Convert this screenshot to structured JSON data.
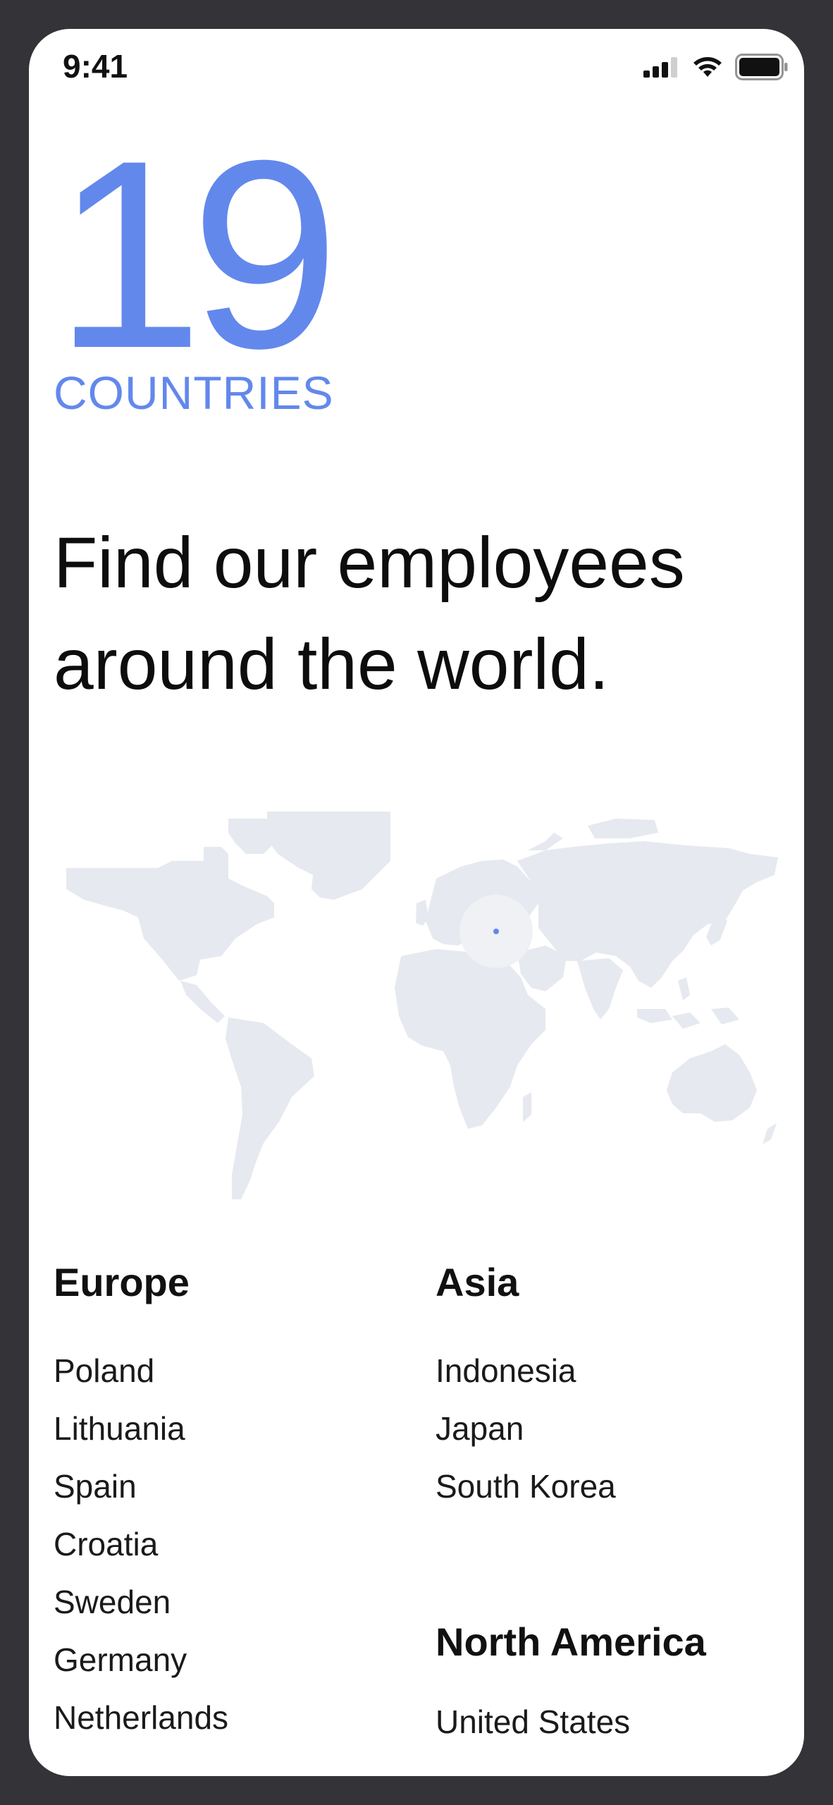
{
  "status_bar": {
    "time": "9:41",
    "icons": [
      "cellular-signal-icon",
      "wifi-icon",
      "battery-icon"
    ]
  },
  "hero": {
    "count": "19",
    "unit": "COUNTRIES",
    "headline_line1": "Find our employees",
    "headline_line2": "around the world."
  },
  "map": {
    "land_color": "#e6e9ef",
    "highlight_color": "#6388ec"
  },
  "regions": {
    "europe": {
      "title": "Europe",
      "countries": [
        "Poland",
        "Lithuania",
        "Spain",
        "Croatia",
        "Sweden",
        "Germany",
        "Netherlands"
      ]
    },
    "asia": {
      "title": "Asia",
      "countries": [
        "Indonesia",
        "Japan",
        "South Korea"
      ]
    },
    "north_america": {
      "title": "North America",
      "countries": [
        "United States"
      ]
    }
  },
  "colors": {
    "accent": "#6388ec",
    "frame": "#333338",
    "text": "#0d0d0d"
  }
}
